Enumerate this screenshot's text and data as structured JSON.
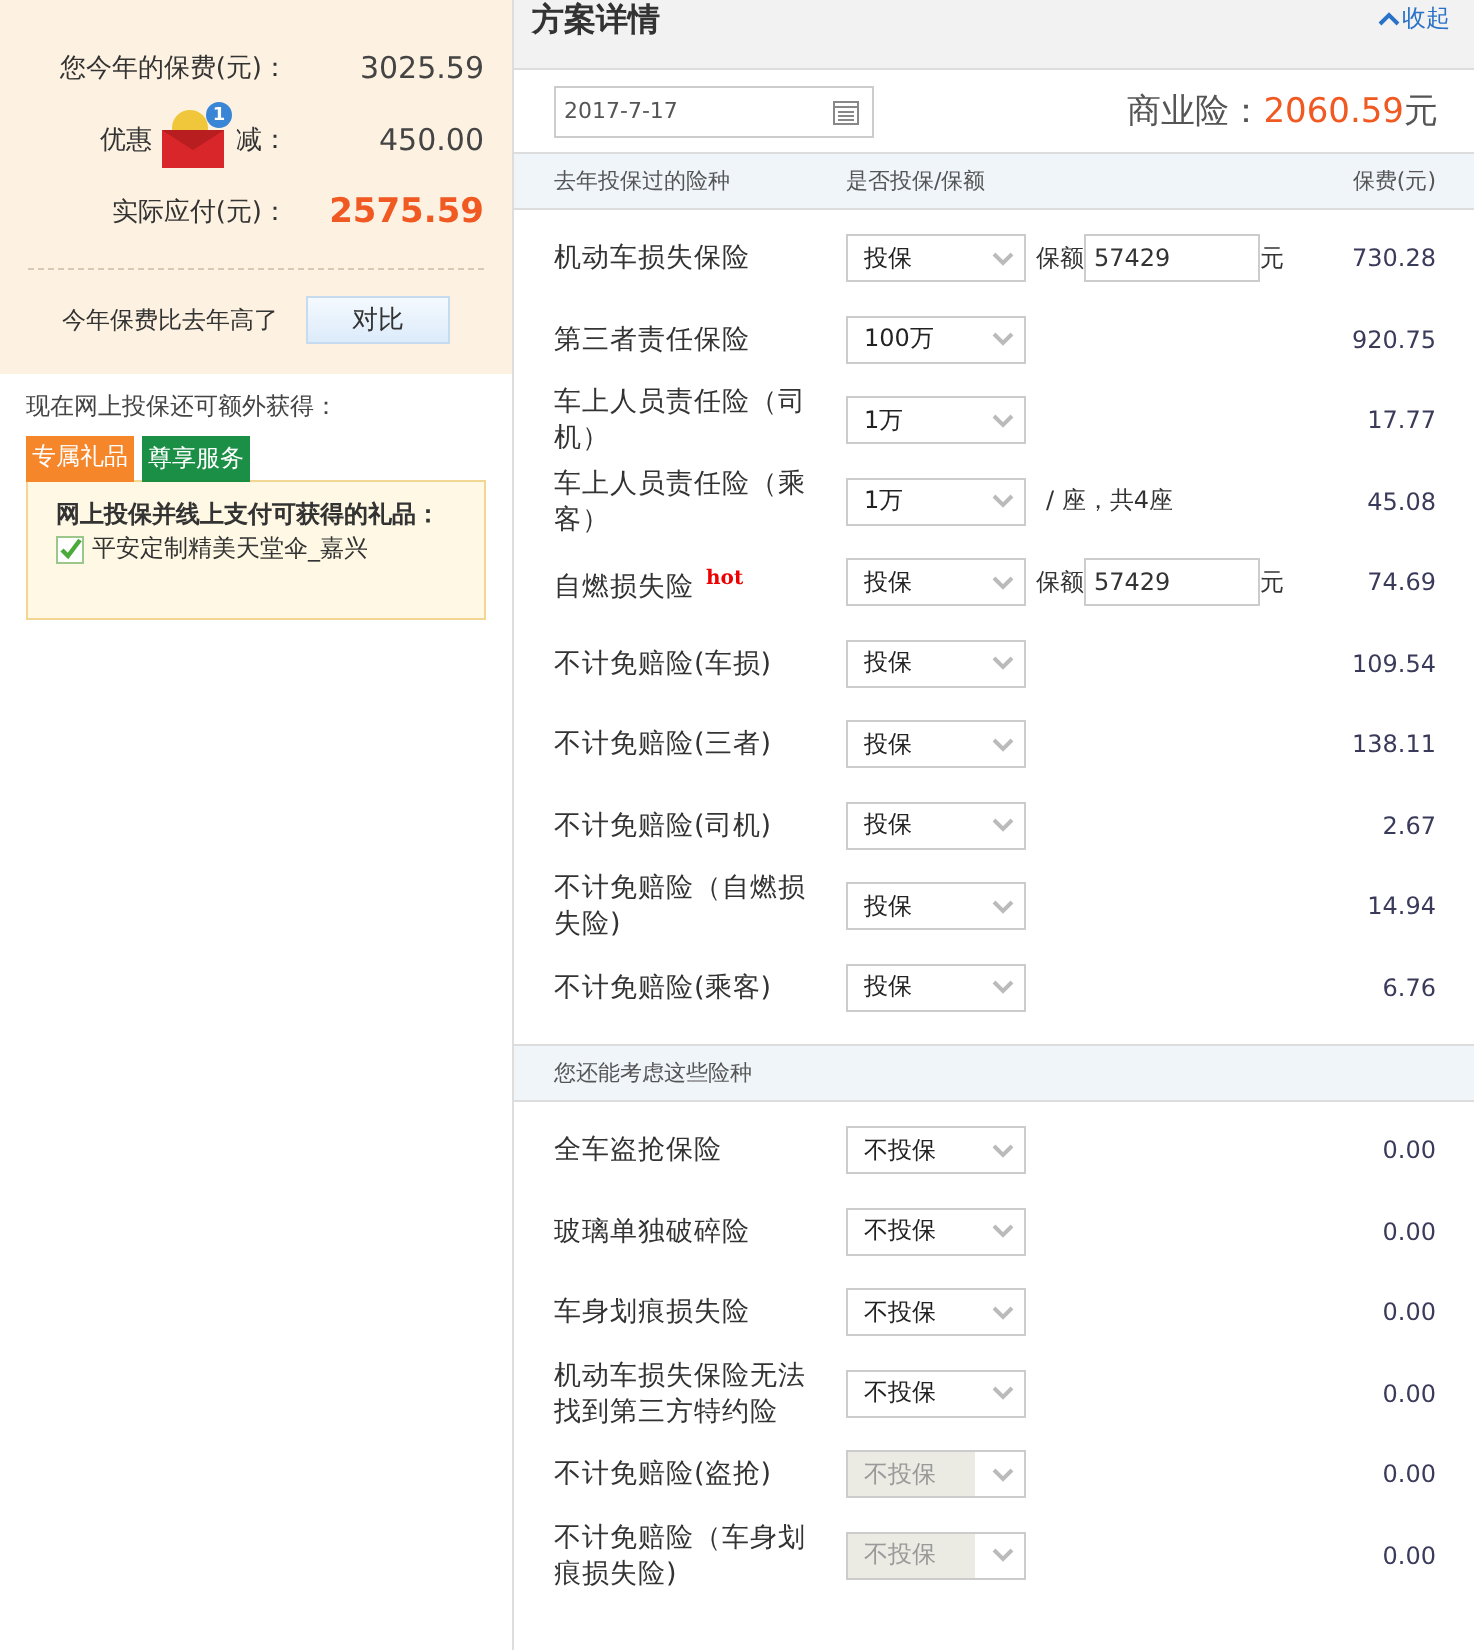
{
  "summary": {
    "rows": [
      {
        "kind": "plain",
        "label": "您今年的保费(元)：",
        "value": "3025.59"
      },
      {
        "kind": "coupon",
        "label": "优惠",
        "label_after": "减：",
        "badge": "1",
        "value": "450.00"
      },
      {
        "kind": "total",
        "label": "实际应付(元)：",
        "value": "2575.59"
      }
    ],
    "compare_text": "今年保费比去年高了",
    "compare_button": "对比"
  },
  "extras": {
    "intro": "现在网上投保还可额外获得：",
    "tabs": [
      {
        "label": "专属礼品",
        "selected": true,
        "color": "#f5862a"
      },
      {
        "label": "尊享服务",
        "selected": false,
        "color": "#0f8a3c"
      }
    ],
    "gift_title": "网上投保并线上支付可获得的礼品：",
    "gifts": [
      {
        "label": "平安定制精美天堂伞_嘉兴",
        "checked": true
      }
    ]
  },
  "plan": {
    "title": "方案详情",
    "collapse": "收起",
    "date": "2017-7-17",
    "commercial_label": "商业险：",
    "commercial_amount": "2060.59",
    "commercial_unit": "元",
    "columns": [
      "去年投保过的险种",
      "是否投保/保额",
      "保费(元)"
    ],
    "rows": [
      {
        "kind": "amount",
        "name": "机动车损失保险",
        "option": "投保",
        "disabled": false,
        "amount_label": "保额",
        "amount_value": "57429",
        "unit": "元",
        "premium": "730.28"
      },
      {
        "kind": "plain",
        "name": "第三者责任保险",
        "option": "100万",
        "disabled": false,
        "premium": "920.75"
      },
      {
        "kind": "plain",
        "name": "车上人员责任险（司机）",
        "option": "1万",
        "disabled": false,
        "premium": "17.77"
      },
      {
        "kind": "seats",
        "name": "车上人员责任险（乘客）",
        "option": "1万",
        "disabled": false,
        "seats_text": "/ 座，共4座",
        "premium": "45.08"
      },
      {
        "kind": "amount",
        "name": "自燃损失险",
        "hot": "hot",
        "option": "投保",
        "disabled": false,
        "amount_label": "保额",
        "amount_value": "57429",
        "unit": "元",
        "premium": "74.69"
      },
      {
        "kind": "plain",
        "name": "不计免赔险(车损)",
        "option": "投保",
        "disabled": false,
        "premium": "109.54"
      },
      {
        "kind": "plain",
        "name": "不计免赔险(三者)",
        "option": "投保",
        "disabled": false,
        "premium": "138.11"
      },
      {
        "kind": "plain",
        "name": "不计免赔险(司机)",
        "option": "投保",
        "disabled": false,
        "premium": "2.67"
      },
      {
        "kind": "plain",
        "name": "不计免赔险（自燃损失险)",
        "option": "投保",
        "disabled": false,
        "premium": "14.94"
      },
      {
        "kind": "plain",
        "name": "不计免赔险(乘客)",
        "option": "投保",
        "disabled": false,
        "premium": "6.76"
      }
    ],
    "more_heading": "您还能考虑这些险种",
    "more_rows": [
      {
        "kind": "plain",
        "name": "全车盗抢保险",
        "option": "不投保",
        "disabled": false,
        "premium": "0.00"
      },
      {
        "kind": "plain",
        "name": "玻璃单独破碎险",
        "option": "不投保",
        "disabled": false,
        "premium": "0.00"
      },
      {
        "kind": "plain",
        "name": "车身划痕损失险",
        "option": "不投保",
        "disabled": false,
        "premium": "0.00"
      },
      {
        "kind": "plain",
        "name": "机动车损失保险无法找到第三方特约险",
        "option": "不投保",
        "disabled": false,
        "premium": "0.00"
      },
      {
        "kind": "plain",
        "name": "不计免赔险(盗抢)",
        "option": "不投保",
        "disabled": true,
        "premium": "0.00"
      },
      {
        "kind": "plain",
        "name": "不计免赔险（车身划痕损失险)",
        "option": "不投保",
        "disabled": true,
        "premium": "0.00"
      }
    ]
  }
}
